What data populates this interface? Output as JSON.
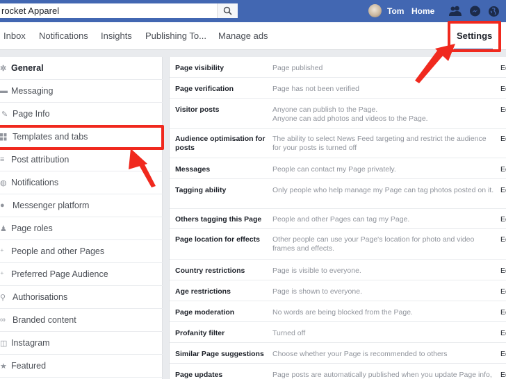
{
  "topbar": {
    "search_value": "rocket Apparel",
    "user_name": "Tom",
    "home_label": "Home",
    "icons": [
      "search-icon",
      "friend-requests-icon",
      "messenger-icon",
      "notifications-globe-icon"
    ]
  },
  "pagenav": {
    "items": [
      "Inbox",
      "Notifications",
      "Insights",
      "Publishing To...",
      "Manage ads"
    ],
    "settings_label": "Settings"
  },
  "sidebar": {
    "items": [
      {
        "label": "General",
        "icon": "gear-icon",
        "active": true
      },
      {
        "label": "Messaging",
        "icon": "message-icon"
      },
      {
        "label": "Page Info",
        "icon": "pencil-icon"
      },
      {
        "label": "Templates and tabs",
        "icon": "grid-icon"
      },
      {
        "label": "Post attribution",
        "icon": "list-icon"
      },
      {
        "label": "Notifications",
        "icon": "globe-icon"
      },
      {
        "label": "Messenger platform",
        "icon": "messenger-icon"
      },
      {
        "label": "Page roles",
        "icon": "person-icon"
      },
      {
        "label": "People and other Pages",
        "icon": "person-add-icon"
      },
      {
        "label": "Preferred Page Audience",
        "icon": "person-add-icon"
      },
      {
        "label": "Authorisations",
        "icon": "wrench-icon"
      },
      {
        "label": "Branded content",
        "icon": "handshake-icon"
      },
      {
        "label": "Instagram",
        "icon": "instagram-icon"
      },
      {
        "label": "Featured",
        "icon": "star-icon"
      }
    ]
  },
  "settings": {
    "edit_label": "Edit",
    "rows": [
      {
        "label": "Page visibility",
        "value": "Page published"
      },
      {
        "label": "Page verification",
        "value": "Page has not been verified"
      },
      {
        "label": "Visitor posts",
        "value": "Anyone can publish to the Page.\nAnyone can add photos and videos to the Page."
      },
      {
        "label": "Audience optimisation for posts",
        "value": "The ability to select News Feed targeting and restrict the audience for your posts is turned off"
      },
      {
        "label": "Messages",
        "value": "People can contact my Page privately."
      },
      {
        "label": "Tagging ability",
        "value": "Only people who help manage my Page can tag photos posted on it."
      },
      {
        "label": "Others tagging this Page",
        "value": "People and other Pages can tag my Page."
      },
      {
        "label": "Page location for effects",
        "value": "Other people can use your Page's location for photo and video frames and effects."
      },
      {
        "label": "Country restrictions",
        "value": "Page is visible to everyone."
      },
      {
        "label": "Age restrictions",
        "value": "Page is shown to everyone."
      },
      {
        "label": "Page moderation",
        "value": "No words are being blocked from the Page."
      },
      {
        "label": "Profanity filter",
        "value": "Turned off"
      },
      {
        "label": "Similar Page suggestions",
        "value": "Choose whether your Page is recommended to others"
      },
      {
        "label": "Page updates",
        "value": "Page posts are automatically published when you update Page info,"
      }
    ]
  },
  "annotations": {
    "highlight_color": "#f0291e",
    "highlighted": [
      "Settings",
      "Templates and tabs"
    ]
  },
  "colors": {
    "brand_blue": "#4267b2"
  }
}
